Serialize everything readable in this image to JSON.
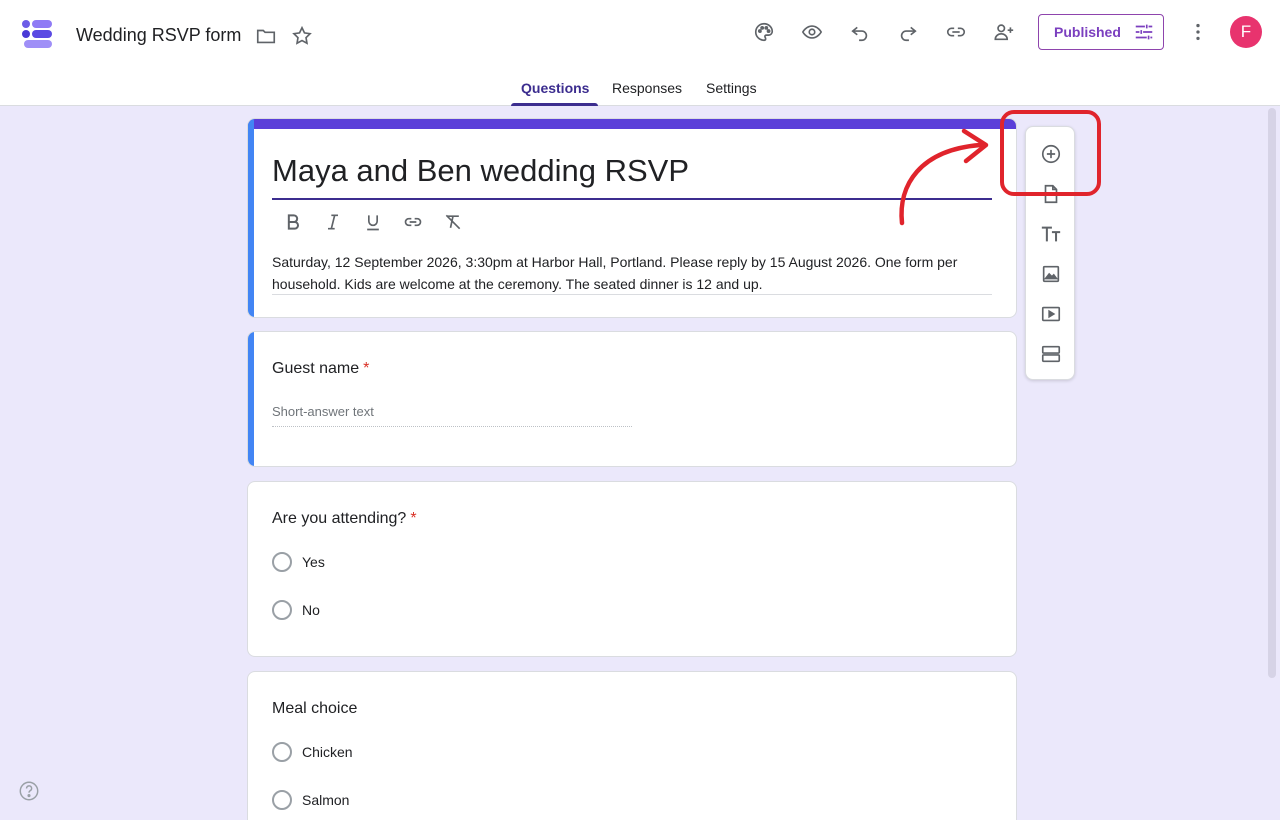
{
  "header": {
    "doc_title": "Wedding RSVP form",
    "published_label": "Published",
    "avatar_initial": "F"
  },
  "tabs": [
    {
      "label": "Questions",
      "active": true
    },
    {
      "label": "Responses",
      "active": false
    },
    {
      "label": "Settings",
      "active": false
    }
  ],
  "form": {
    "title": "Maya and Ben wedding RSVP",
    "description": "Saturday, 12 September 2026, 3:30pm at Harbor Hall, Portland. Please reply by 15 August 2026. One form per household. Kids are welcome at the ceremony. The seated dinner is 12 and up."
  },
  "questions": [
    {
      "label": "Guest name",
      "required": true,
      "required_mark": "*",
      "placeholder": "Short-answer text"
    },
    {
      "label": "Are you attending?",
      "required": true,
      "required_mark": "*",
      "options": [
        "Yes",
        "No"
      ]
    },
    {
      "label": "Meal choice",
      "required": false,
      "options": [
        "Chicken",
        "Salmon"
      ]
    }
  ],
  "colors": {
    "accent": "#5b3fd9",
    "question_strip": "#4285f4",
    "highlight": "#e0242c",
    "background": "#ebe8fb",
    "avatar": "#e8336e"
  },
  "icons": [
    "palette-icon",
    "preview-eye-icon",
    "undo-icon",
    "redo-icon",
    "link-icon",
    "add-collaborator-icon",
    "tune-icon",
    "more-vert-icon",
    "folder-icon",
    "star-icon",
    "add-question-icon",
    "import-questions-icon",
    "add-title-icon",
    "add-image-icon",
    "add-video-icon",
    "add-section-icon",
    "help-icon"
  ]
}
